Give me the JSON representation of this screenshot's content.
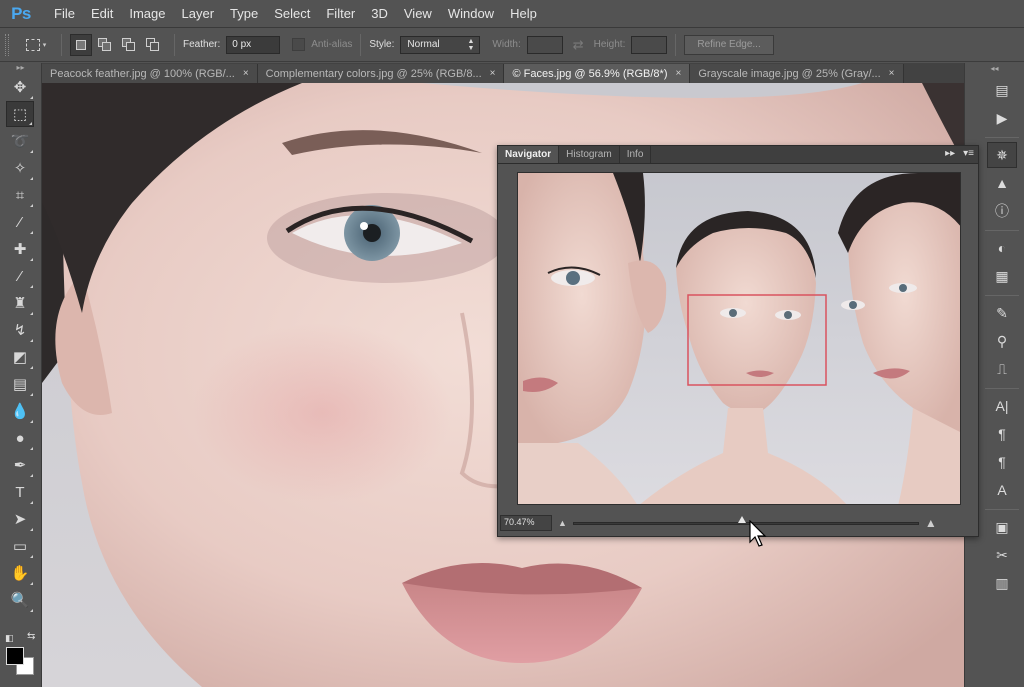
{
  "app": {
    "logo": "Ps"
  },
  "menu": [
    "File",
    "Edit",
    "Image",
    "Layer",
    "Type",
    "Select",
    "Filter",
    "3D",
    "View",
    "Window",
    "Help"
  ],
  "options": {
    "feather_label": "Feather:",
    "feather_value": "0 px",
    "antialias_label": "Anti-alias",
    "style_label": "Style:",
    "style_value": "Normal",
    "width_label": "Width:",
    "height_label": "Height:",
    "refine_edge": "Refine Edge..."
  },
  "tabs": [
    {
      "label": "Peacock feather.jpg @ 100% (RGB/...",
      "active": false
    },
    {
      "label": "Complementary colors.jpg @ 25% (RGB/8...",
      "active": false
    },
    {
      "label": "© Faces.jpg @ 56.9% (RGB/8*)",
      "active": true
    },
    {
      "label": "Grayscale image.jpg @ 25% (Gray/...",
      "active": false
    }
  ],
  "tab_close_glyph": "×",
  "tools": [
    {
      "name": "move-tool-icon",
      "glyph": "✥"
    },
    {
      "name": "marquee-tool-icon",
      "glyph": "⬚",
      "active": true
    },
    {
      "name": "lasso-tool-icon",
      "glyph": "➰"
    },
    {
      "name": "magic-wand-tool-icon",
      "glyph": "✧"
    },
    {
      "name": "crop-tool-icon",
      "glyph": "⌗"
    },
    {
      "name": "eyedropper-tool-icon",
      "glyph": "⁄"
    },
    {
      "name": "healing-brush-tool-icon",
      "glyph": "✚"
    },
    {
      "name": "brush-tool-icon",
      "glyph": "⁄"
    },
    {
      "name": "clone-stamp-tool-icon",
      "glyph": "♜"
    },
    {
      "name": "history-brush-tool-icon",
      "glyph": "↯"
    },
    {
      "name": "eraser-tool-icon",
      "glyph": "◩"
    },
    {
      "name": "gradient-tool-icon",
      "glyph": "▤"
    },
    {
      "name": "blur-tool-icon",
      "glyph": "💧"
    },
    {
      "name": "dodge-tool-icon",
      "glyph": "●"
    },
    {
      "name": "pen-tool-icon",
      "glyph": "✒"
    },
    {
      "name": "type-tool-icon",
      "glyph": "T"
    },
    {
      "name": "path-selection-tool-icon",
      "glyph": "➤"
    },
    {
      "name": "shape-tool-icon",
      "glyph": "▭"
    },
    {
      "name": "hand-tool-icon",
      "glyph": "✋"
    },
    {
      "name": "zoom-tool-icon",
      "glyph": "🔍"
    }
  ],
  "dock": [
    {
      "name": "history-panel-icon",
      "glyph": "▤"
    },
    {
      "name": "actions-panel-icon",
      "glyph": "▶"
    },
    {
      "name": "navigator-panel-icon",
      "glyph": "✵",
      "active": true
    },
    {
      "name": "histogram-panel-icon",
      "glyph": "▲"
    },
    {
      "name": "info-panel-icon",
      "glyph": "ⓘ"
    },
    {
      "name": "adjustments-panel-icon",
      "glyph": "◐"
    },
    {
      "name": "properties-panel-icon",
      "glyph": "▦"
    },
    {
      "name": "brush-panel-icon",
      "glyph": "✎"
    },
    {
      "name": "brush-presets-panel-icon",
      "glyph": "⚲"
    },
    {
      "name": "clone-source-panel-icon",
      "glyph": "⎍"
    },
    {
      "name": "character-panel-icon",
      "glyph": "A|"
    },
    {
      "name": "paragraph-panel-icon",
      "glyph": "¶"
    },
    {
      "name": "paragraph-styles-panel-icon",
      "glyph": "¶"
    },
    {
      "name": "character-styles-panel-icon",
      "glyph": "A"
    },
    {
      "name": "layer-comps-panel-icon",
      "glyph": "▣"
    },
    {
      "name": "tool-presets-panel-icon",
      "glyph": "✂"
    },
    {
      "name": "notes-panel-icon",
      "glyph": "▥"
    }
  ],
  "navigator": {
    "tabs": [
      "Navigator",
      "Histogram",
      "Info"
    ],
    "active_tab": "Navigator",
    "zoom_value": "70.47%",
    "zoom_slider_fraction": 0.49,
    "header_buttons": [
      "▸▸",
      "▾≡"
    ]
  },
  "colors": {
    "view_box": "#d9535f",
    "ps_blue": "#4aa8f0"
  }
}
